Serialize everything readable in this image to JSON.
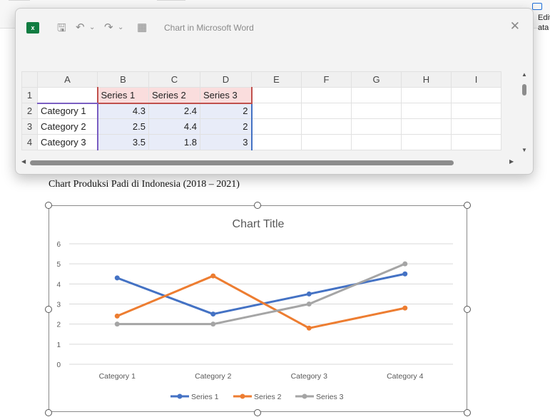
{
  "word": {
    "right_label_line1": "Edit",
    "right_label_line2": "ata"
  },
  "excel": {
    "window_title": "Chart in Microsoft Word",
    "app_badge": "x",
    "columns": [
      "A",
      "B",
      "C",
      "D",
      "E",
      "F",
      "G",
      "H",
      "I"
    ],
    "rows": [
      [
        "",
        "Series 1",
        "Series 2",
        "Series 3",
        "",
        "",
        "",
        "",
        ""
      ],
      [
        "Category 1",
        "4.3",
        "2.4",
        "2",
        "",
        "",
        "",
        "",
        ""
      ],
      [
        "Category 2",
        "2.5",
        "4.4",
        "2",
        "",
        "",
        "",
        "",
        ""
      ],
      [
        "Category 3",
        "3.5",
        "1.8",
        "3",
        "",
        "",
        "",
        "",
        ""
      ]
    ],
    "row_numbers": [
      "1",
      "2",
      "3",
      "4"
    ]
  },
  "caption": "Chart Produksi Padi di Indonesia (2018 – 2021)",
  "colors": {
    "series1": "#4472c4",
    "series2": "#ed7d31",
    "series3": "#a5a5a5"
  },
  "chart_data": {
    "type": "line",
    "title": "Chart Title",
    "categories": [
      "Category 1",
      "Category 2",
      "Category 3",
      "Category 4"
    ],
    "series": [
      {
        "name": "Series 1",
        "values": [
          4.3,
          2.5,
          3.5,
          4.5
        ]
      },
      {
        "name": "Series 2",
        "values": [
          2.4,
          4.4,
          1.8,
          2.8
        ]
      },
      {
        "name": "Series 3",
        "values": [
          2,
          2,
          3,
          5
        ]
      }
    ],
    "ylim": [
      0,
      6
    ],
    "yticks": [
      "0",
      "1",
      "2",
      "3",
      "4",
      "5",
      "6"
    ],
    "grid": true,
    "legend": "bottom"
  }
}
